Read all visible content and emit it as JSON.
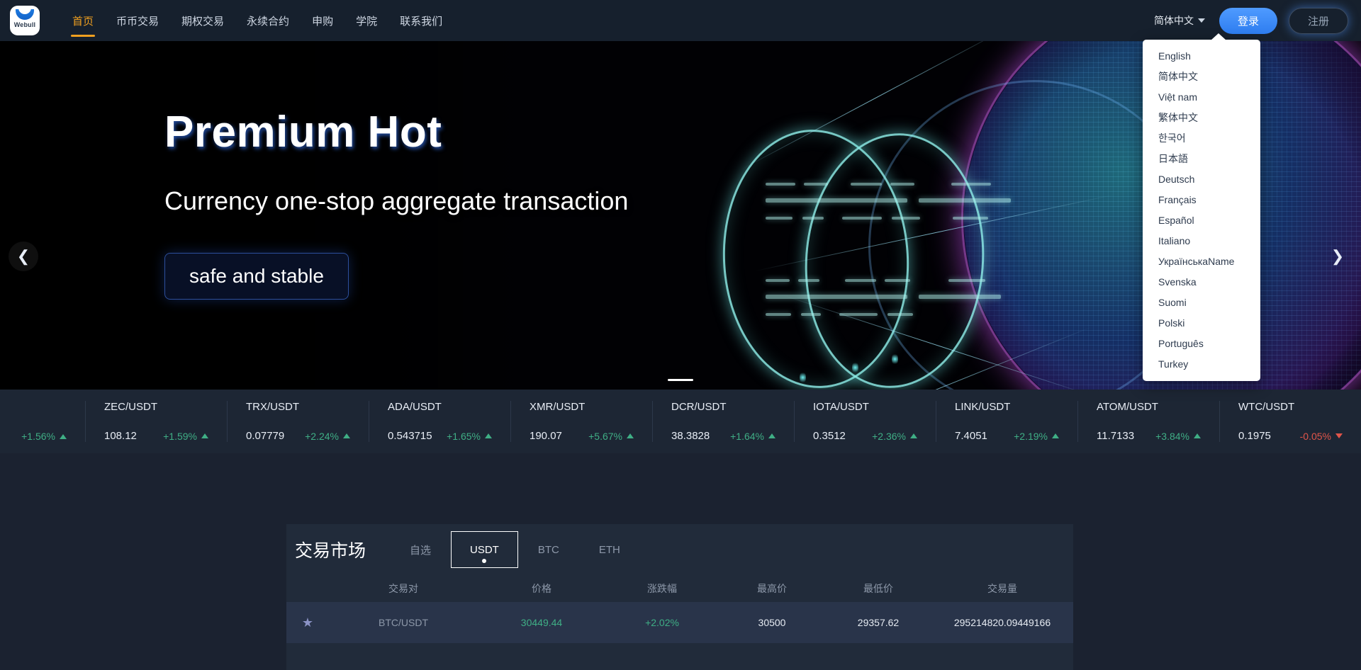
{
  "header": {
    "logo_text": "Webull",
    "nav": [
      {
        "label": "首页",
        "active": true
      },
      {
        "label": "币币交易",
        "active": false
      },
      {
        "label": "期权交易",
        "active": false
      },
      {
        "label": "永续合约",
        "active": false
      },
      {
        "label": "申购",
        "active": false
      },
      {
        "label": "学院",
        "active": false
      },
      {
        "label": "联系我们",
        "active": false
      }
    ],
    "language_current": "简体中文",
    "login_label": "登录",
    "register_label": "注册"
  },
  "language_menu": {
    "open": true,
    "options": [
      "English",
      "简体中文",
      "Việt nam",
      "繁体中文",
      "한국어",
      "日本語",
      "Deutsch",
      "Français",
      "Español",
      "Italiano",
      "УкраїнськаName",
      "Svenska",
      "Suomi",
      "Polski",
      "Português",
      "Turkey"
    ]
  },
  "hero": {
    "title": "Premium Hot",
    "subtitle": "Currency one-stop aggregate transaction",
    "cta_label": "safe and stable",
    "prev_icon": "chevron-left-icon",
    "next_icon": "chevron-right-icon",
    "slide_index": 1,
    "slide_count": 1
  },
  "ticker": [
    {
      "pair": "",
      "price": "",
      "change": "+1.56%",
      "dir": "up"
    },
    {
      "pair": "ZEC/USDT",
      "price": "108.12",
      "change": "+1.59%",
      "dir": "up"
    },
    {
      "pair": "TRX/USDT",
      "price": "0.07779",
      "change": "+2.24%",
      "dir": "up"
    },
    {
      "pair": "ADA/USDT",
      "price": "0.543715",
      "change": "+1.65%",
      "dir": "up"
    },
    {
      "pair": "XMR/USDT",
      "price": "190.07",
      "change": "+5.67%",
      "dir": "up"
    },
    {
      "pair": "DCR/USDT",
      "price": "38.3828",
      "change": "+1.64%",
      "dir": "up"
    },
    {
      "pair": "IOTA/USDT",
      "price": "0.3512",
      "change": "+2.36%",
      "dir": "up"
    },
    {
      "pair": "LINK/USDT",
      "price": "7.4051",
      "change": "+2.19%",
      "dir": "up"
    },
    {
      "pair": "ATOM/USDT",
      "price": "11.7133",
      "change": "+3.84%",
      "dir": "up"
    },
    {
      "pair": "WTC/USDT",
      "price": "0.1975",
      "change": "-0.05%",
      "dir": "down"
    }
  ],
  "market": {
    "title": "交易市场",
    "tabs": [
      {
        "label": "自选",
        "active": false
      },
      {
        "label": "USDT",
        "active": true
      },
      {
        "label": "BTC",
        "active": false
      },
      {
        "label": "ETH",
        "active": false
      }
    ],
    "columns": [
      "",
      "交易对",
      "价格",
      "涨跌幅",
      "最高价",
      "最低价",
      "交易量"
    ],
    "rows": [
      {
        "favorite_icon": "star-icon",
        "pair": "BTC/USDT",
        "price": "30449.44",
        "change": "+2.02%",
        "high": "30500",
        "low": "29357.62",
        "volume": "295214820.09449166"
      }
    ]
  },
  "colors": {
    "accent_orange": "#f0a020",
    "accent_blue": "#3e8bf5",
    "up_green": "#3fae85",
    "down_red": "#e1554a",
    "page_bg": "#1b2230",
    "header_bg": "#16202d",
    "panel_bg": "#212b3a"
  }
}
